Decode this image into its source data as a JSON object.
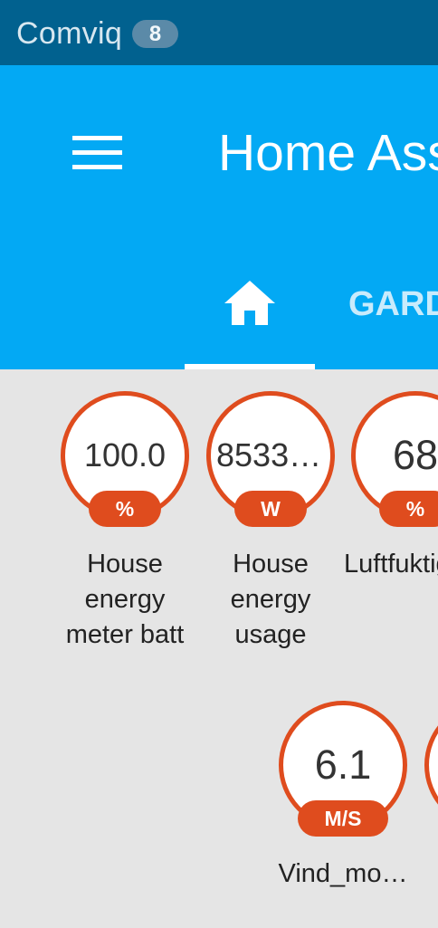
{
  "status_bar": {
    "carrier": "Comviq",
    "notification_count": "8"
  },
  "header": {
    "title": "Home Assistant",
    "tabs": [
      {
        "label": "",
        "icon": "home-icon",
        "selected": true
      },
      {
        "label": "GARDEN",
        "selected": false
      }
    ]
  },
  "badges": [
    {
      "value": "100.0",
      "unit": "%",
      "name": "House energy meter batt"
    },
    {
      "value": "8533.…",
      "unit": "W",
      "name": "House energy usage"
    },
    {
      "value": "68",
      "unit": "%",
      "name": "Luftfuktighet"
    },
    {
      "value": "6.1",
      "unit": "M/S",
      "name": "Vind_mo…"
    }
  ],
  "colors": {
    "status_bar": "#01618f",
    "header": "#03a9f4",
    "badge_accent": "#df4c1e",
    "background": "#e5e5e5"
  }
}
